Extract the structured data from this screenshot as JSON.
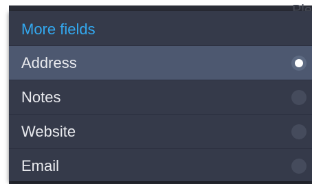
{
  "backdrop": {
    "partial_text": "Ple"
  },
  "dialog": {
    "title": "More fields",
    "options": [
      {
        "label": "Address",
        "selected": true
      },
      {
        "label": "Notes",
        "selected": false
      },
      {
        "label": "Website",
        "selected": false
      },
      {
        "label": "Email",
        "selected": false
      }
    ]
  },
  "colors": {
    "title": "#33a9f0",
    "dialog_bg": "#353a4a",
    "selected_row_bg": "#4d5870",
    "text": "#e9eaee"
  }
}
